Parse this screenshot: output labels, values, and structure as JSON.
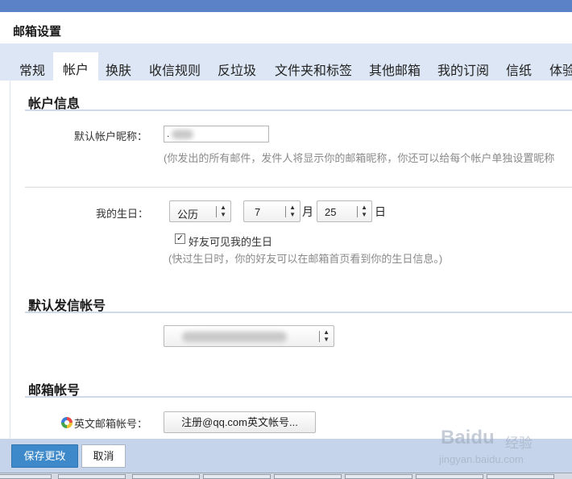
{
  "page": {
    "title": "邮箱设置"
  },
  "tabs": [
    {
      "label": "常规"
    },
    {
      "label": "帐户"
    },
    {
      "label": "换肤"
    },
    {
      "label": "收信规则"
    },
    {
      "label": "反垃圾"
    },
    {
      "label": "文件夹和标签"
    },
    {
      "label": "其他邮箱"
    },
    {
      "label": "我的订阅"
    },
    {
      "label": "信纸"
    },
    {
      "label": "体验"
    }
  ],
  "active_tab": "帐户",
  "account_info": {
    "section_title": "帐户信息",
    "nickname_label": "默认帐户昵称：",
    "nickname_value": ".",
    "nickname_hint": "(你发出的所有邮件，发件人将显示你的邮箱昵称，你还可以给每个帐户单独设置昵称",
    "birthday_label": "我的生日：",
    "calendar_value": "公历",
    "month_value": "7",
    "month_unit": "月",
    "day_value": "25",
    "day_unit": "日",
    "friends_visible_checked": true,
    "friends_visible_label": "好友可见我的生日",
    "birthday_hint": "(快过生日时，你的好友可以在邮箱首页看到你的生日信息。)"
  },
  "default_sender": {
    "section_title": "默认发信帐号",
    "select_value": ""
  },
  "mailbox_account": {
    "section_title": "邮箱帐号",
    "english_label": "英文邮箱帐号：",
    "register_button": "注册@qq.com英文帐号..."
  },
  "footer": {
    "save_label": "保存更改",
    "cancel_label": "取消"
  },
  "watermark": {
    "logo_text": "Baidu",
    "logo_cn": "经验",
    "url": "jingyan.baidu.com"
  },
  "colors": {
    "topbar": "#5b82c6",
    "tabbar": "#dce6f4",
    "primary_button": "#3d89c9",
    "footer": "#c5d4ea"
  }
}
